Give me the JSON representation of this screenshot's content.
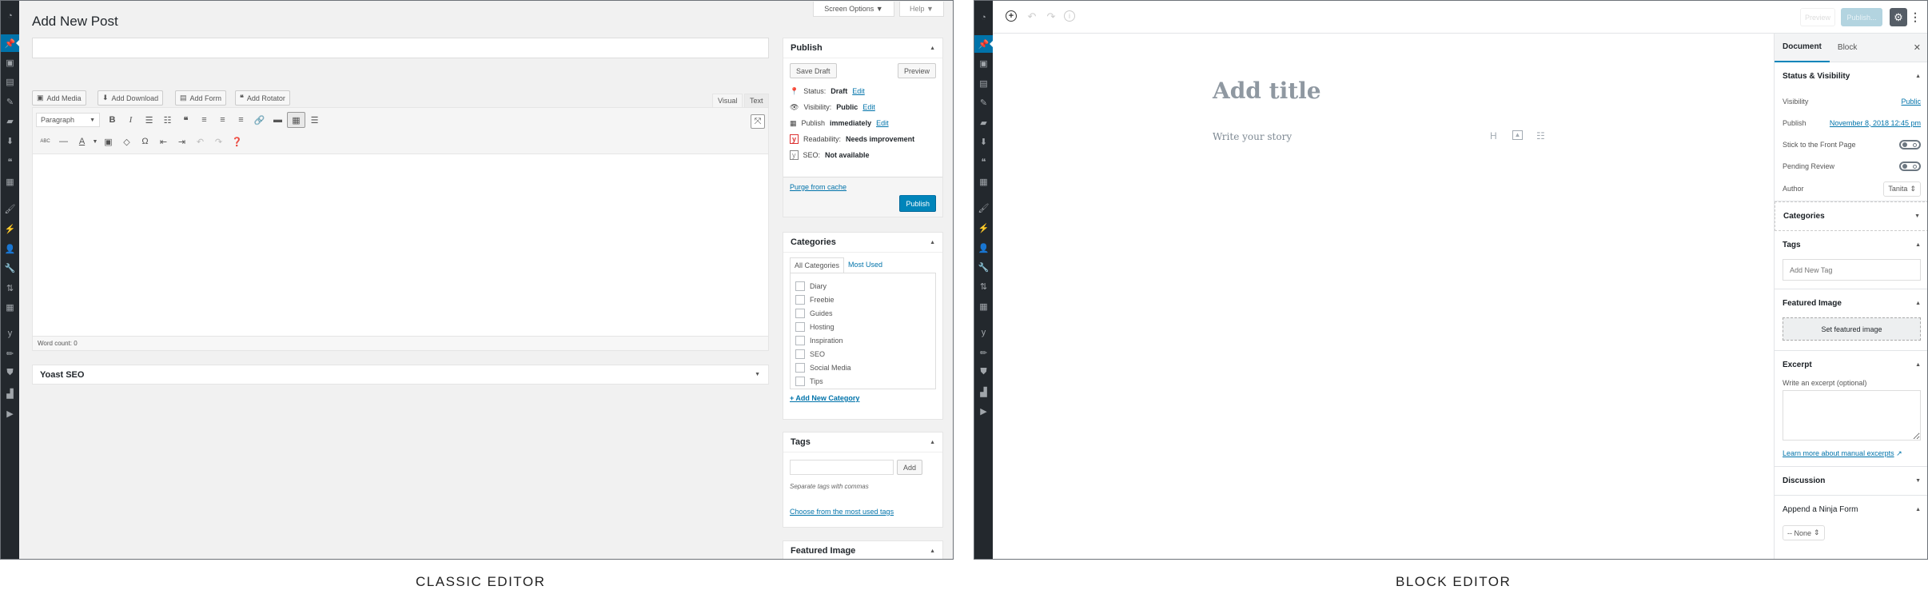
{
  "classic": {
    "caption": "CLASSIC EDITOR",
    "page_title": "Add New Post",
    "screen_options_label": "Screen Options ▼",
    "help_label": "Help ▼",
    "title_input": {
      "value": "",
      "placeholder": ""
    },
    "media_buttons": [
      {
        "label": "Add Media",
        "icon": "media-icon"
      },
      {
        "label": "Add Download",
        "icon": "download-icon"
      },
      {
        "label": "Add Form",
        "icon": "form-icon"
      },
      {
        "label": "Add Rotator",
        "icon": "quote-icon"
      }
    ],
    "editor_tabs": {
      "visual": "Visual",
      "text": "Text"
    },
    "format_select": "Paragraph",
    "word_count": "Word count: 0",
    "yoast_label": "Yoast SEO",
    "publish_box": {
      "title": "Publish",
      "save_draft": "Save Draft",
      "preview": "Preview",
      "status_label": "Status:",
      "status_value": "Draft",
      "visibility_label": "Visibility:",
      "visibility_value": "Public",
      "publish_label": "Publish",
      "publish_value": "immediately",
      "readability_label": "Readability:",
      "readability_value": "Needs improvement",
      "seo_label": "SEO:",
      "seo_value": "Not available",
      "edit_link": "Edit",
      "purge_link": "Purge from cache",
      "publish_button": "Publish"
    },
    "categories_box": {
      "title": "Categories",
      "tab_all": "All Categories",
      "tab_most": "Most Used",
      "items": [
        "Diary",
        "Freebie",
        "Guides",
        "Hosting",
        "Inspiration",
        "SEO",
        "Social Media",
        "Tips"
      ],
      "add_new": "+ Add New Category"
    },
    "tags_box": {
      "title": "Tags",
      "input_value": "",
      "add_button": "Add",
      "hint": "Separate tags with commas",
      "choose_link": "Choose from the most used tags"
    },
    "featured_box": {
      "title": "Featured Image"
    }
  },
  "block": {
    "caption": "BLOCK EDITOR",
    "header": {
      "preview": "Preview",
      "publish": "Publish..."
    },
    "title_placeholder": "Add title",
    "story_placeholder": "Write your story",
    "sidebar": {
      "tab_document": "Document",
      "tab_block": "Block",
      "status_title": "Status & Visibility",
      "visibility_label": "Visibility",
      "visibility_value": "Public",
      "publish_label": "Publish",
      "publish_value": "November 8, 2018 12:45 pm",
      "sticky_label": "Stick to the Front Page",
      "pending_label": "Pending Review",
      "author_label": "Author",
      "author_value": "Tanita",
      "categories_title": "Categories",
      "tags_title": "Tags",
      "tags_placeholder": "Add New Tag",
      "featured_title": "Featured Image",
      "featured_button": "Set featured image",
      "excerpt_title": "Excerpt",
      "excerpt_label": "Write an excerpt (optional)",
      "excerpt_link": "Learn more about manual excerpts",
      "discussion_title": "Discussion",
      "ninja_title": "Append a Ninja Form",
      "ninja_select": "-- None"
    }
  }
}
